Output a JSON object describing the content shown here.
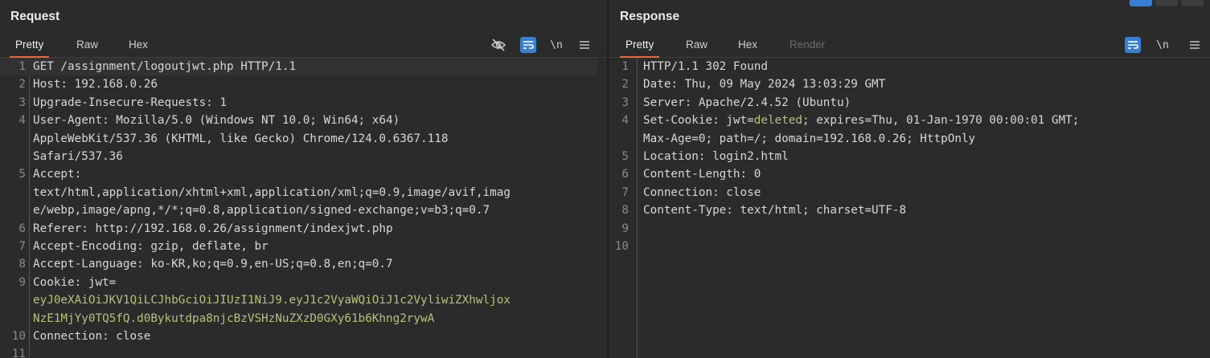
{
  "request": {
    "title": "Request",
    "tabs": [
      "Pretty",
      "Raw",
      "Hex"
    ],
    "lines": [
      {
        "n": "1",
        "parts": [
          {
            "t": "GET /assignment/logoutjwt.php HTTP/1.1",
            "c": "k"
          }
        ]
      },
      {
        "n": "2",
        "parts": [
          {
            "t": "Host: 192.168.0.26",
            "c": "k"
          }
        ]
      },
      {
        "n": "3",
        "parts": [
          {
            "t": "Upgrade-Insecure-Requests: 1",
            "c": "k"
          }
        ]
      },
      {
        "n": "4",
        "parts": [
          {
            "t": "User-Agent: Mozilla/5.0 (Windows NT 10.0; Win64; x64)",
            "c": "k"
          }
        ]
      },
      {
        "n": "",
        "parts": [
          {
            "t": "AppleWebKit/537.36 (KHTML, like Gecko) Chrome/124.0.6367.118",
            "c": "v"
          }
        ]
      },
      {
        "n": "",
        "parts": [
          {
            "t": "Safari/537.36",
            "c": "v"
          }
        ]
      },
      {
        "n": "5",
        "parts": [
          {
            "t": "Accept:",
            "c": "k"
          }
        ]
      },
      {
        "n": "",
        "parts": [
          {
            "t": "text/html,application/xhtml+xml,application/xml;q=0.9,image/avif,imag",
            "c": "v"
          }
        ]
      },
      {
        "n": "",
        "parts": [
          {
            "t": "e/webp,image/apng,*/*;q=0.8,application/signed-exchange;v=b3;q=0.7",
            "c": "v"
          }
        ]
      },
      {
        "n": "6",
        "parts": [
          {
            "t": "Referer: http://192.168.0.26/assignment/indexjwt.php",
            "c": "k"
          }
        ]
      },
      {
        "n": "7",
        "parts": [
          {
            "t": "Accept-Encoding: gzip, deflate, br",
            "c": "k"
          }
        ]
      },
      {
        "n": "8",
        "parts": [
          {
            "t": "Accept-Language: ko-KR,ko;q=0.9,en-US;q=0.8,en;q=0.7",
            "c": "k"
          }
        ]
      },
      {
        "n": "9",
        "parts": [
          {
            "t": "Cookie: jwt=",
            "c": "k"
          }
        ]
      },
      {
        "n": "",
        "parts": [
          {
            "t": "eyJ0eXAiOiJKV1QiLCJhbGciOiJIUzI1NiJ9.eyJ1c2VyaWQiOiJ1c2VyliwiZXhwljox",
            "c": "y"
          }
        ]
      },
      {
        "n": "",
        "parts": [
          {
            "t": "NzE1MjYy0TQ5fQ.d0Bykutdpa8njcBzVSHzNuZXzD0GXy61b6Khng2rywA",
            "c": "y"
          }
        ]
      },
      {
        "n": "10",
        "parts": [
          {
            "t": "Connection: close",
            "c": "k"
          }
        ]
      },
      {
        "n": "11",
        "parts": []
      }
    ]
  },
  "response": {
    "title": "Response",
    "tabs": [
      "Pretty",
      "Raw",
      "Hex",
      "Render"
    ],
    "lines": [
      {
        "n": "1",
        "parts": [
          {
            "t": "HTTP/1.1 302 Found",
            "c": "k"
          }
        ]
      },
      {
        "n": "2",
        "parts": [
          {
            "t": "Date: Thu, 09 May 2024 13:03:29 GMT",
            "c": "k"
          }
        ]
      },
      {
        "n": "3",
        "parts": [
          {
            "t": "Server: Apache/2.4.52 (Ubuntu)",
            "c": "k"
          }
        ]
      },
      {
        "n": "4",
        "parts": [
          {
            "t": "Set-Cookie: jwt=",
            "c": "k"
          },
          {
            "t": "deleted",
            "c": "y"
          },
          {
            "t": "; expires=Thu, 01-Jan-1970 00:00:01 GMT;",
            "c": "k"
          }
        ]
      },
      {
        "n": "",
        "parts": [
          {
            "t": "Max-Age=0; path=/; domain=192.168.0.26; HttpOnly",
            "c": "v"
          }
        ]
      },
      {
        "n": "5",
        "parts": [
          {
            "t": "Location: login2.html",
            "c": "k"
          }
        ]
      },
      {
        "n": "6",
        "parts": [
          {
            "t": "Content-Length: 0",
            "c": "k"
          }
        ]
      },
      {
        "n": "7",
        "parts": [
          {
            "t": "Connection: close",
            "c": "k"
          }
        ]
      },
      {
        "n": "8",
        "parts": [
          {
            "t": "Content-Type: text/html; charset=UTF-8",
            "c": "k"
          }
        ]
      },
      {
        "n": "9",
        "parts": []
      },
      {
        "n": "10",
        "parts": []
      }
    ]
  },
  "icons": {
    "hide": "eye-off-icon",
    "wrap": "text-wrap-icon",
    "newline": "\\n",
    "menu": "hamburger-menu-icon"
  },
  "colors": {
    "accent_tab": "#e8693a",
    "active_button": "#3a7fd6",
    "token": "#b4c27a"
  }
}
